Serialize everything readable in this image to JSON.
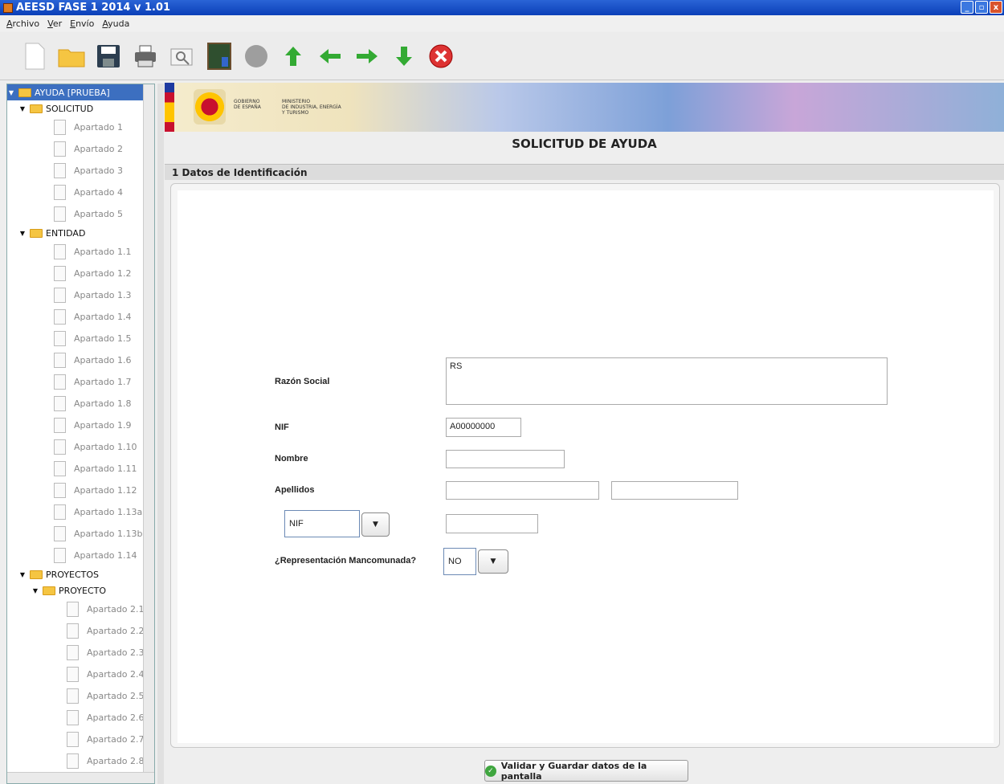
{
  "window": {
    "title": "AEESD FASE 1 2014  v 1.01"
  },
  "menu": [
    "Archivo",
    "Ver",
    "Envío",
    "Ayuda"
  ],
  "toolbar": [
    {
      "icon": "new-document-icon"
    },
    {
      "icon": "open-folder-icon"
    },
    {
      "icon": "save-disk-icon"
    },
    {
      "icon": "print-icon"
    },
    {
      "icon": "preview-icon"
    },
    {
      "icon": "chalkboard-icon"
    },
    {
      "icon": "circle-icon"
    },
    {
      "icon": "arrow-up-icon"
    },
    {
      "icon": "arrow-left-icon"
    },
    {
      "icon": "arrow-right-icon"
    },
    {
      "icon": "arrow-down-icon"
    },
    {
      "icon": "close-icon"
    }
  ],
  "tree": {
    "root": "AYUDA [PRUEBA]",
    "solicitud": {
      "label": "SOLICITUD",
      "items": [
        "Apartado 1",
        "Apartado 2",
        "Apartado 3",
        "Apartado 4",
        "Apartado 5"
      ]
    },
    "entidad": {
      "label": "ENTIDAD",
      "items": [
        "Apartado 1.1",
        "Apartado 1.2",
        "Apartado 1.3",
        "Apartado 1.4",
        "Apartado 1.5",
        "Apartado 1.6",
        "Apartado 1.7",
        "Apartado 1.8",
        "Apartado 1.9",
        "Apartado 1.10",
        "Apartado 1.11",
        "Apartado 1.12",
        "Apartado 1.13a",
        "Apartado 1.13b",
        "Apartado 1.14"
      ]
    },
    "proyectos": {
      "label": "PROYECTOS"
    },
    "proyecto": {
      "label": "PROYECTO",
      "items": [
        "Apartado 2.1",
        "Apartado 2.2",
        "Apartado 2.3",
        "Apartado 2.4",
        "Apartado 2.5",
        "Apartado 2.6",
        "Apartado 2.7",
        "Apartado 2.8"
      ]
    }
  },
  "banner": {
    "gobierno": "GOBIERNO\nDE ESPAÑA",
    "ministerio": "MINISTERIO\nDE INDUSTRIA, ENERGÍA\nY TURISMO"
  },
  "page_title": "SOLICITUD DE AYUDA",
  "section": "1 Datos de Identificación",
  "form": {
    "razon_social": {
      "label": "Razón Social",
      "value": "RS"
    },
    "nif": {
      "label": "NIF",
      "value": "A00000000"
    },
    "nombre": {
      "label": "Nombre",
      "value": ""
    },
    "apellidos": {
      "label": "Apellidos",
      "value1": "",
      "value2": ""
    },
    "doc_type": {
      "selected": "NIF",
      "value": ""
    },
    "mancomunada": {
      "label": "¿Representación Mancomunada?",
      "selected": "NO"
    }
  },
  "save_button": "Validar y Guardar datos de la pantalla"
}
